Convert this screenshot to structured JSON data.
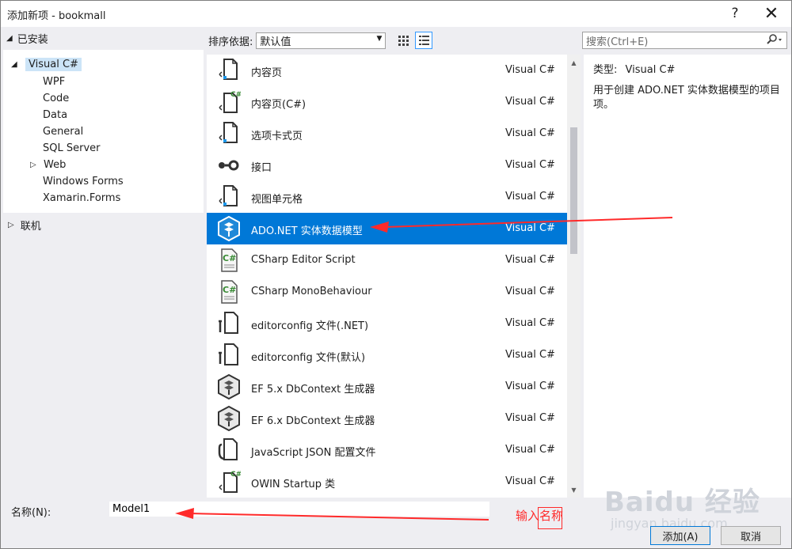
{
  "window": {
    "title": "添加新项 - bookmall",
    "help": "?",
    "close": "✕"
  },
  "tree": {
    "installed": "已安装",
    "root": "Visual C#",
    "children": [
      "WPF",
      "Code",
      "Data",
      "General",
      "SQL Server",
      "Web",
      "Windows Forms",
      "Xamarin.Forms"
    ],
    "online": "联机"
  },
  "sort": {
    "label": "排序依据:",
    "value": "默认值"
  },
  "search": {
    "placeholder": "搜索(Ctrl+E)"
  },
  "templates": [
    {
      "name": "内容页",
      "lang": "Visual C#",
      "icon": "page-icon"
    },
    {
      "name": "内容页(C#)",
      "lang": "Visual C#",
      "icon": "csharp-page-icon"
    },
    {
      "name": "选项卡式页",
      "lang": "Visual C#",
      "icon": "page-icon"
    },
    {
      "name": "接口",
      "lang": "Visual C#",
      "icon": "interface-icon"
    },
    {
      "name": "视图单元格",
      "lang": "Visual C#",
      "icon": "page-icon"
    },
    {
      "name": "ADO.NET 实体数据模型",
      "lang": "Visual C#",
      "icon": "entity-model-icon",
      "selected": true
    },
    {
      "name": "CSharp Editor Script",
      "lang": "Visual C#",
      "icon": "csharp-file-icon"
    },
    {
      "name": "CSharp MonoBehaviour",
      "lang": "Visual C#",
      "icon": "csharp-file-icon"
    },
    {
      "name": "editorconfig 文件(.NET)",
      "lang": "Visual C#",
      "icon": "wrench-file-icon"
    },
    {
      "name": "editorconfig 文件(默认)",
      "lang": "Visual C#",
      "icon": "wrench-file-icon"
    },
    {
      "name": "EF 5.x DbContext 生成器",
      "lang": "Visual C#",
      "icon": "entity-model-icon"
    },
    {
      "name": "EF 6.x DbContext 生成器",
      "lang": "Visual C#",
      "icon": "entity-model-icon"
    },
    {
      "name": "JavaScript JSON 配置文件",
      "lang": "Visual C#",
      "icon": "json-file-icon"
    },
    {
      "name": "OWIN Startup 类",
      "lang": "Visual C#",
      "icon": "csharp-page-icon"
    }
  ],
  "details": {
    "type_label": "类型:",
    "type_value": "Visual C#",
    "description": "用于创建 ADO.NET 实体数据模型的项目项。"
  },
  "bottom": {
    "name_label": "名称(N):",
    "name_value": "Model1",
    "annotation": "输入名称",
    "add_label": "添加(A)",
    "cancel_label": "取消"
  },
  "watermark": {
    "brand": "Baidu 经验",
    "site": "jingyan.baidu.com"
  },
  "colors": {
    "selection": "#0078d7",
    "annotation": "#ff2a2a",
    "background": "#eeeef2"
  }
}
